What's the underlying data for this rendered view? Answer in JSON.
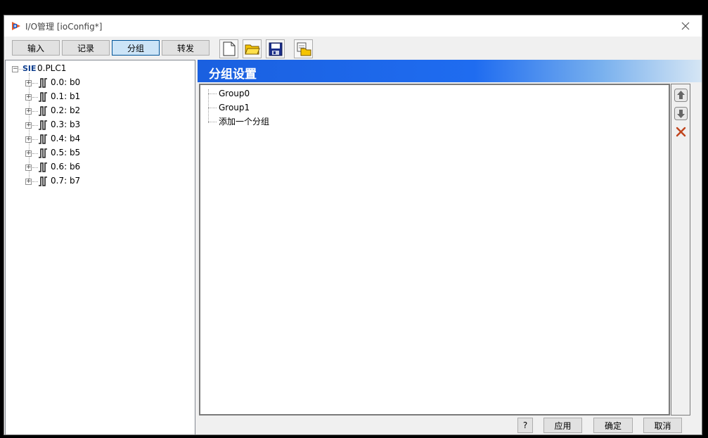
{
  "window": {
    "title": "I/O管理 [ioConfig*]"
  },
  "toolbar": {
    "tabs": [
      {
        "label": "输入"
      },
      {
        "label": "记录"
      },
      {
        "label": "分组"
      },
      {
        "label": "转发"
      }
    ],
    "active_tab": "分组",
    "tools": [
      "new-file-icon",
      "open-folder-icon",
      "save-icon",
      "import-icon"
    ]
  },
  "tree": {
    "root": {
      "badge": "SIE",
      "label": "0.PLC1"
    },
    "items": [
      {
        "label": "0.0: b0"
      },
      {
        "label": "0.1: b1"
      },
      {
        "label": "0.2: b2"
      },
      {
        "label": "0.3: b3"
      },
      {
        "label": "0.4: b4"
      },
      {
        "label": "0.5: b5"
      },
      {
        "label": "0.6: b6"
      },
      {
        "label": "0.7: b7"
      }
    ]
  },
  "group_panel": {
    "title": "分组设置",
    "groups": [
      {
        "label": "Group0"
      },
      {
        "label": "Group1"
      },
      {
        "label": "添加一个分组"
      }
    ]
  },
  "footer": {
    "help_label": "?",
    "apply_label": "应用",
    "ok_label": "确定",
    "cancel_label": "取消"
  },
  "colors": {
    "accent": "#1f6cf0",
    "active_tab_bg": "#cce4f7",
    "delete_red": "#c0441c"
  }
}
